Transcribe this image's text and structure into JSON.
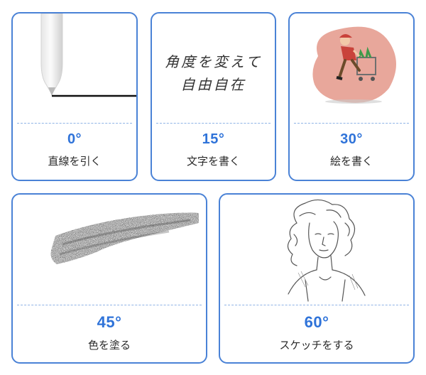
{
  "cards": [
    {
      "angle": "0°",
      "caption": "直線を引く"
    },
    {
      "angle": "15°",
      "caption": "文字を書く",
      "art_text_line1": "角度を変えて",
      "art_text_line2": "自由自在"
    },
    {
      "angle": "30°",
      "caption": "絵を書く"
    },
    {
      "angle": "45°",
      "caption": "色を塗る"
    },
    {
      "angle": "60°",
      "caption": "スケッチをする"
    }
  ],
  "colors": {
    "border": "#4a82d6",
    "angle_text": "#2f73d9",
    "divider": "#8fb3e6",
    "blob": "#e8a79b"
  },
  "icons": [
    "stylus-pen-icon",
    "girl-with-cart-illustration",
    "pencil-shading-scribble",
    "girl-portrait-sketch"
  ]
}
